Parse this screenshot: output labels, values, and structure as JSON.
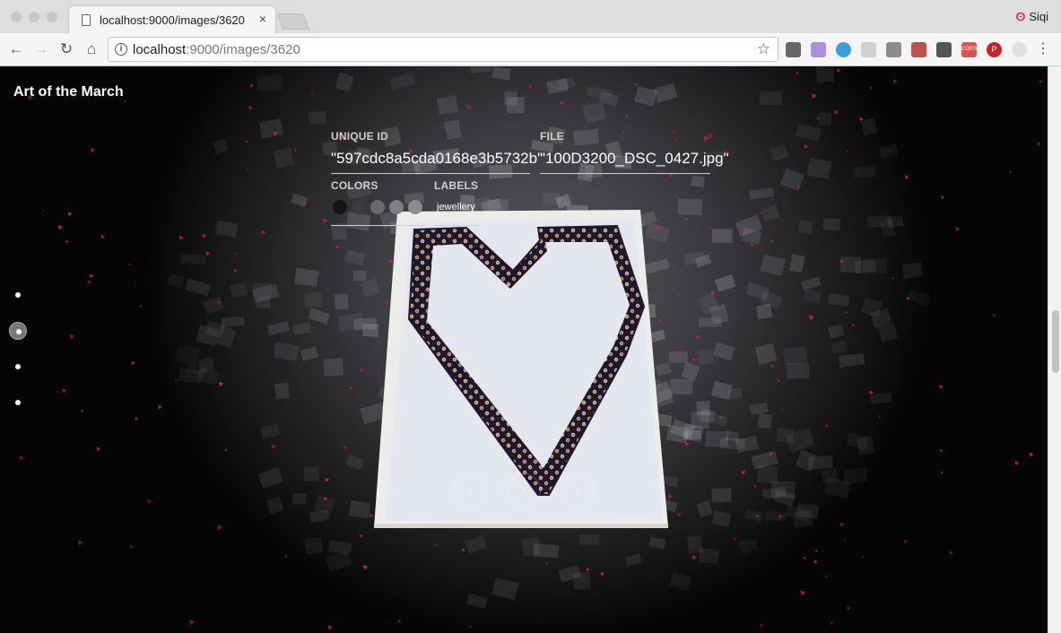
{
  "browser": {
    "tab_title": "localhost:9000/images/3620",
    "tab_close": "×",
    "profile_name": "Siqi",
    "profile_icon": "ⵙ",
    "address_host": "localhost",
    "address_rest": ":9000/images/3620",
    "back": "←",
    "forward": "→",
    "reload": "↻",
    "home": "⌂",
    "star": "☆",
    "menu": "⋮",
    "extensions": [
      {
        "name": "video-ext-icon",
        "color": "#666666",
        "text": ""
      },
      {
        "name": "pen-ext-icon",
        "color": "#b08de0",
        "text": ""
      },
      {
        "name": "circle-ext-icon",
        "color": "#3aa0d8",
        "text": ""
      },
      {
        "name": "gray-ext-icon",
        "color": "#d0d0d0",
        "text": ""
      },
      {
        "name": "square-ext-icon",
        "color": "#8c8c8c",
        "text": ""
      },
      {
        "name": "photo-ext-icon",
        "color": "#c0504d",
        "text": ""
      },
      {
        "name": "crop-ext-icon",
        "color": "#555555",
        "text": ""
      },
      {
        "name": "cors-ext-icon",
        "color": "#d9534f",
        "text": "CORS"
      },
      {
        "name": "pinterest-ext-icon",
        "color": "#cb2027",
        "text": "P"
      },
      {
        "name": "faded-ext-icon",
        "color": "#e0e0e0",
        "text": ""
      }
    ]
  },
  "app": {
    "title": "Art of the March"
  },
  "nav_dots": [
    {
      "active": false
    },
    {
      "active": true
    },
    {
      "active": false
    },
    {
      "active": false
    }
  ],
  "details": {
    "unique_id_label": "UNIQUE ID",
    "unique_id_value": "\"597cdc8a5cda0168e3b5732b\"",
    "file_label": "FILE",
    "file_value": "\"100D3200_DSC_0427.jpg\"",
    "colors_label": "COLORS",
    "colors": [
      "#151515",
      "#3b3b3b",
      "#6a6a6a",
      "#7e7e7e",
      "#8c8c8c"
    ],
    "labels_label": "LABELS",
    "labels": [
      "jewellery"
    ]
  },
  "controls": {
    "prev": "‹",
    "close": "×",
    "next": "›"
  },
  "colors": {
    "accent_particles": "#d81b60",
    "tape_dark": "#1d1730",
    "paper": "#e6e9ee"
  }
}
